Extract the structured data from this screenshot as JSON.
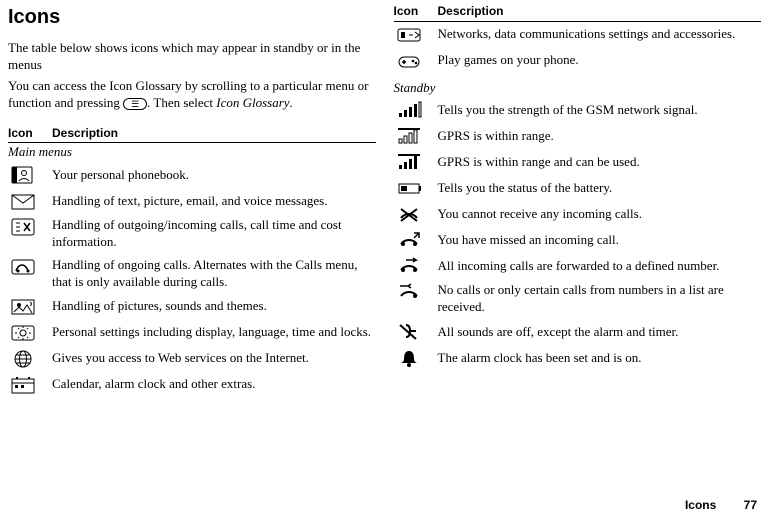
{
  "page": {
    "title": "Icons",
    "intro1": "The table below shows icons which may appear in standby or in the menus",
    "intro2_a": "You can access the Icon Glossary by scrolling to a particular menu or function and pressing ",
    "intro2_b": ". Then select ",
    "intro2_glossary": "Icon Glossary",
    "intro2_c": ".",
    "menu_key_glyph": "☰"
  },
  "headers": {
    "icon": "Icon",
    "description": "Description"
  },
  "sections": {
    "main_menus": "Main menus",
    "standby": "Standby"
  },
  "left_rows": [
    {
      "icon": "phonebook",
      "desc": "Your personal phonebook."
    },
    {
      "icon": "messages",
      "desc": "Handling of text, picture, email, and voice messages."
    },
    {
      "icon": "call-info",
      "desc": "Handling of outgoing/incoming calls, call time and cost information."
    },
    {
      "icon": "ongoing-calls",
      "desc": "Handling of ongoing calls. Alternates with the Calls menu, that is only available during calls."
    },
    {
      "icon": "pictures-sounds",
      "desc": "Handling of pictures, sounds and themes."
    },
    {
      "icon": "settings",
      "desc": "Personal settings including display, language, time and locks."
    },
    {
      "icon": "web",
      "desc": "Gives you access to Web services on the Internet."
    },
    {
      "icon": "extras",
      "desc": "Calendar, alarm clock and other extras."
    }
  ],
  "right_top_rows": [
    {
      "icon": "connect",
      "desc": "Networks, data communications settings and accessories."
    },
    {
      "icon": "games",
      "desc": "Play games on your phone."
    }
  ],
  "right_standby_rows": [
    {
      "icon": "signal",
      "desc": "Tells you the strength of the GSM network signal."
    },
    {
      "icon": "gprs-range",
      "desc": "GPRS is within range."
    },
    {
      "icon": "gprs-use",
      "desc": "GPRS is within range and can be used."
    },
    {
      "icon": "battery",
      "desc": "Tells you the status of the battery."
    },
    {
      "icon": "no-calls",
      "desc": "You cannot receive any incoming calls."
    },
    {
      "icon": "missed-call",
      "desc": "You have missed an incoming call."
    },
    {
      "icon": "forward",
      "desc": "All incoming calls are forwarded to a defined number."
    },
    {
      "icon": "call-list",
      "desc": "No calls or only certain calls from numbers in a list are received."
    },
    {
      "icon": "silent",
      "desc": "All sounds are off, except the alarm and timer."
    },
    {
      "icon": "alarm",
      "desc": "The alarm clock has been set and is on."
    }
  ],
  "footer": {
    "label": "Icons",
    "page": "77"
  }
}
